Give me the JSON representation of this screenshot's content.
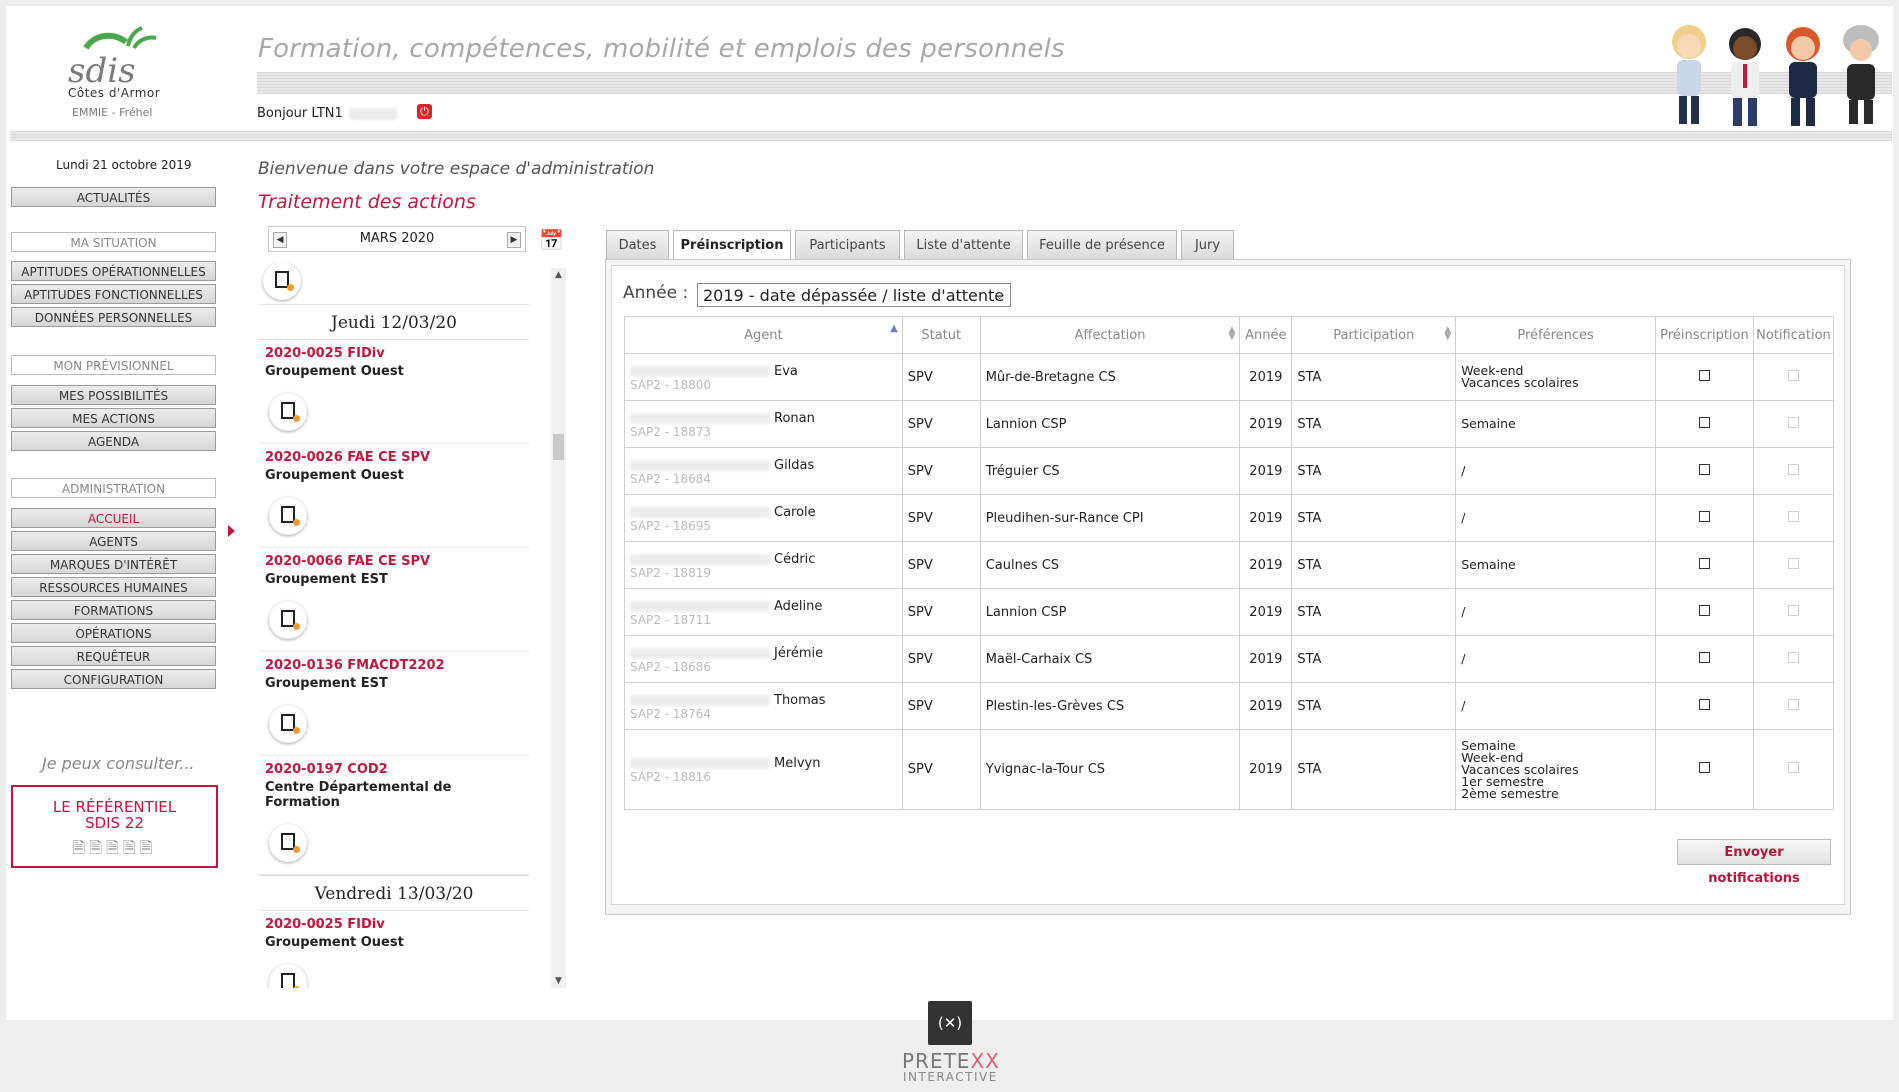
{
  "header": {
    "title": "Formation, compétences, mobilité et emplois des personnels",
    "greeting": "Bonjour LTN1",
    "logo_text": "sdis",
    "logo_sub": "Côtes d'Armor",
    "site": "EMMIE - Fréhel"
  },
  "sidebar": {
    "date": "Lundi 21 octobre 2019",
    "actualites": "ACTUALITÉS",
    "ma_situation": "MA SITUATION",
    "situation_items": [
      "APTITUDES OPÉRATIONNELLES",
      "APTITUDES FONCTIONNELLES",
      "DONNÉES PERSONNELLES"
    ],
    "mon_previsionnel": "MON PRÉVISIONNEL",
    "previsionnel_items": [
      "MES POSSIBILITÉS",
      "MES ACTIONS",
      "AGENDA"
    ],
    "administration": "ADMINISTRATION",
    "admin_items": [
      "ACCUEIL",
      "AGENTS",
      "MARQUES D'INTÉRÊT",
      "RESSOURCES HUMAINES",
      "FORMATIONS",
      "OPÉRATIONS",
      "REQUÊTEUR",
      "CONFIGURATION"
    ],
    "consult": "Je peux consulter...",
    "referentiel_line1": "LE RÉFÉRENTIEL",
    "referentiel_line2": "SDIS 22"
  },
  "main": {
    "welcome": "Bienvenue dans votre espace d'administration",
    "section": "Traitement des actions"
  },
  "calendar": {
    "month": "MARS 2020",
    "days": [
      {
        "label": "Jeudi 12/03/20",
        "events": [
          {
            "code": "2020-0025 FIDiv",
            "group": "Groupement Ouest"
          },
          {
            "code": "2020-0026 FAE CE SPV",
            "group": "Groupement Ouest"
          },
          {
            "code": "2020-0066 FAE CE SPV",
            "group": "Groupement EST"
          },
          {
            "code": "2020-0136 FMACDT2202",
            "group": "Groupement EST"
          },
          {
            "code": "2020-0197 COD2",
            "group": "Centre Départemental de Formation"
          }
        ]
      },
      {
        "label": "Vendredi 13/03/20",
        "events": [
          {
            "code": "2020-0025 FIDiv",
            "group": "Groupement Ouest"
          }
        ]
      }
    ]
  },
  "tabs": [
    "Dates",
    "Préinscription",
    "Participants",
    "Liste d'attente",
    "Feuille de présence",
    "Jury"
  ],
  "active_tab": "Préinscription",
  "filter": {
    "label": "Année :",
    "value": "2019 - date dépassée / liste d'attente"
  },
  "table": {
    "headers": [
      "Agent",
      "Statut",
      "Affectation",
      "Année",
      "Participation",
      "Préférences",
      "Préinscription",
      "Notification"
    ],
    "rows": [
      {
        "name": "Eva",
        "sub": "SAP2 - 18800",
        "statut": "SPV",
        "affectation": "Mûr-de-Bretagne CS",
        "annee": "2019",
        "participation": "STA",
        "prefs": [
          "Week-end",
          "Vacances scolaires"
        ]
      },
      {
        "name": "Ronan",
        "sub": "SAP2 - 18873",
        "statut": "SPV",
        "affectation": "Lannion CSP",
        "annee": "2019",
        "participation": "STA",
        "prefs": [
          "Semaine"
        ]
      },
      {
        "name": "Gildas",
        "sub": "SAP2 - 18684",
        "statut": "SPV",
        "affectation": "Tréguier CS",
        "annee": "2019",
        "participation": "STA",
        "prefs": [
          "/"
        ]
      },
      {
        "name": "Carole",
        "sub": "SAP2 - 18695",
        "statut": "SPV",
        "affectation": "Pleudihen-sur-Rance CPI",
        "annee": "2019",
        "participation": "STA",
        "prefs": [
          "/"
        ]
      },
      {
        "name": "Cédric",
        "sub": "SAP2 - 18819",
        "statut": "SPV",
        "affectation": "Caulnes CS",
        "annee": "2019",
        "participation": "STA",
        "prefs": [
          "Semaine"
        ]
      },
      {
        "name": "Adeline",
        "sub": "SAP2 - 18711",
        "statut": "SPV",
        "affectation": "Lannion CSP",
        "annee": "2019",
        "participation": "STA",
        "prefs": [
          "/"
        ]
      },
      {
        "name": "Jérémie",
        "sub": "SAP2 - 18686",
        "statut": "SPV",
        "affectation": "Maël-Carhaix CS",
        "annee": "2019",
        "participation": "STA",
        "prefs": [
          "/"
        ]
      },
      {
        "name": "Thomas",
        "sub": "SAP2 - 18764",
        "statut": "SPV",
        "affectation": "Plestin-les-Grèves CS",
        "annee": "2019",
        "participation": "STA",
        "prefs": [
          "/"
        ]
      },
      {
        "name": "Melvyn",
        "sub": "SAP2 - 18816",
        "statut": "SPV",
        "affectation": "Yvignac-la-Tour CS",
        "annee": "2019",
        "participation": "STA",
        "prefs": [
          "Semaine",
          "Week-end",
          "Vacances scolaires",
          "1er semestre",
          "2ème semestre"
        ]
      }
    ]
  },
  "send_button": "Envoyer notifications",
  "footer": {
    "brand": "PRETE",
    "brand_x": "XX",
    "brand_sub": "INTERACTIVE"
  }
}
